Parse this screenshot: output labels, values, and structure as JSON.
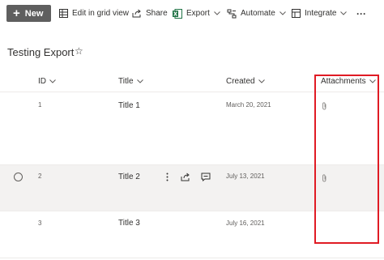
{
  "toolbar": {
    "new_label": "New",
    "edit_grid_label": "Edit in grid view",
    "share_label": "Share",
    "export_label": "Export",
    "automate_label": "Automate",
    "integrate_label": "Integrate",
    "more_label": "···"
  },
  "list": {
    "title": "Testing Export",
    "favorite_icon": "☆"
  },
  "columns": {
    "id": "ID",
    "title": "Title",
    "created": "Created",
    "attachments": "Attachments"
  },
  "rows": [
    {
      "id": "1",
      "title": "Title 1",
      "created": "March 20, 2021",
      "has_attachment": true
    },
    {
      "id": "2",
      "title": "Title 2",
      "created": "July 13, 2021",
      "has_attachment": true
    },
    {
      "id": "3",
      "title": "Title 3",
      "created": "July 16, 2021",
      "has_attachment": false
    }
  ],
  "colors": {
    "new_button_bg": "#5f5f5f",
    "excel_green": "#217346",
    "highlight_red": "#e01b24",
    "selected_row_bg": "#f3f2f1"
  }
}
